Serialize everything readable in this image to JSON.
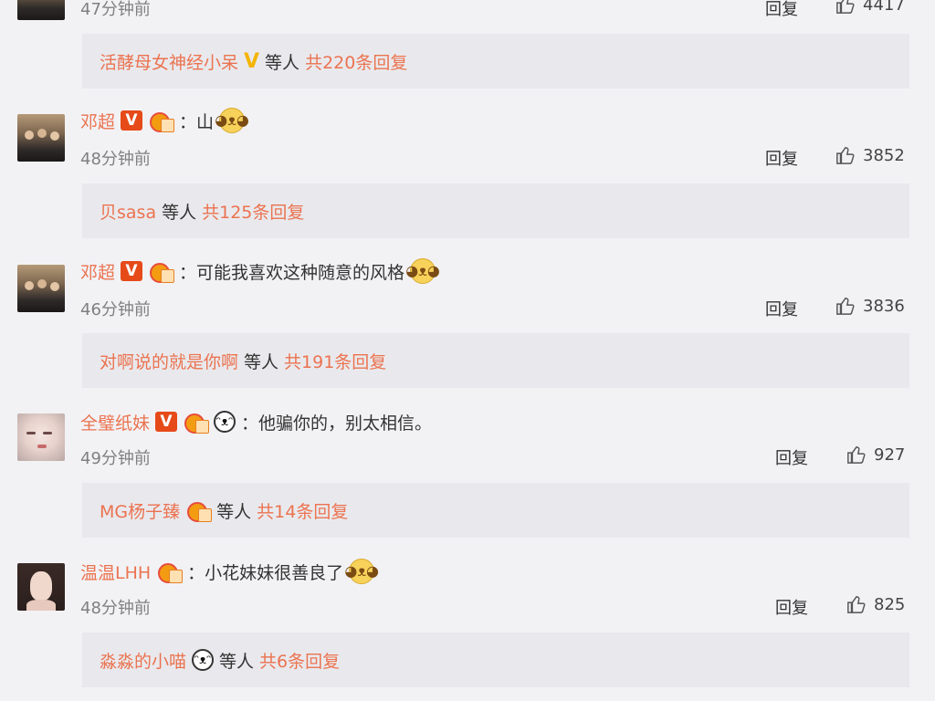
{
  "comments": [
    {
      "time": "47分钟前",
      "reply_label": "回复",
      "likes": "4417",
      "sub": {
        "names": "活酵母女神经小呆",
        "badge": "V",
        "etc": "等人",
        "count": "共220条回复"
      }
    },
    {
      "user": "邓超",
      "content": "：山",
      "emoji": "cat-face",
      "time": "48分钟前",
      "reply_label": "回复",
      "likes": "3852",
      "sub": {
        "names": "贝sasa",
        "etc": "等人",
        "count": "共125条回复"
      }
    },
    {
      "user": "邓超",
      "content": "：可能我喜欢这种随意的风格",
      "emoji": "cat-face",
      "time": "46分钟前",
      "reply_label": "回复",
      "likes": "3836",
      "sub": {
        "names": "对啊说的就是你啊",
        "etc": "等人",
        "count": "共191条回复"
      }
    },
    {
      "user": "全璧纸妹",
      "content": "：他骗你的，别太相信。",
      "time": "49分钟前",
      "reply_label": "回复",
      "likes": "927",
      "sub": {
        "names": "MG杨子臻",
        "etc": "等人",
        "count": "共14条回复"
      }
    },
    {
      "user": "温温LHH",
      "content": "：小花妹妹很善良了",
      "emoji": "cat-face",
      "time": "48分钟前",
      "reply_label": "回复",
      "likes": "825",
      "sub": {
        "names": "淼淼的小喵",
        "etc": "等人",
        "count": "共6条回复"
      }
    }
  ],
  "icons": {
    "verified": "V",
    "thumb": "thumbs-up-icon",
    "cat_emoji": "cat-face-emoji",
    "panda_emoji": "panda-emoji",
    "medal": "fan-medal-icon"
  },
  "colors": {
    "username": "#eb7350",
    "verified_bg": "#e64a19",
    "gold_v": "#f4b400",
    "background": "#f2f2f5",
    "reply_box": "#e9e9ed"
  }
}
